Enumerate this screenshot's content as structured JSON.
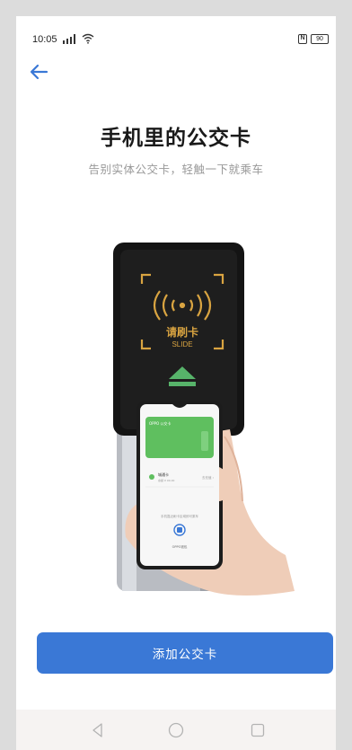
{
  "status_bar": {
    "time": "10:05",
    "battery": "90",
    "nfc": "N"
  },
  "header": {
    "title": "手机里的公交卡",
    "subtitle": "告别实体公交卡，轻触一下就乘车"
  },
  "illustration": {
    "reader_label": "请刷卡",
    "reader_label_en": "SLIDE",
    "phone_card_title": "OPPO 公交卡",
    "phone_card_row_name": "城通卡",
    "phone_card_row_sub": "余额 ¥ 00.00",
    "phone_card_row_value": "去充值 ›",
    "phone_hint": "手机靠近刷卡区域即可乘车",
    "phone_brand": "OPPO钱包"
  },
  "actions": {
    "add_card_label": "添加公交卡"
  },
  "nav": {
    "back": "back",
    "home": "home",
    "recents": "recents"
  },
  "colors": {
    "accent": "#3a78d6",
    "reader_gold": "#d9a441",
    "card_green": "#5fbf5f"
  }
}
